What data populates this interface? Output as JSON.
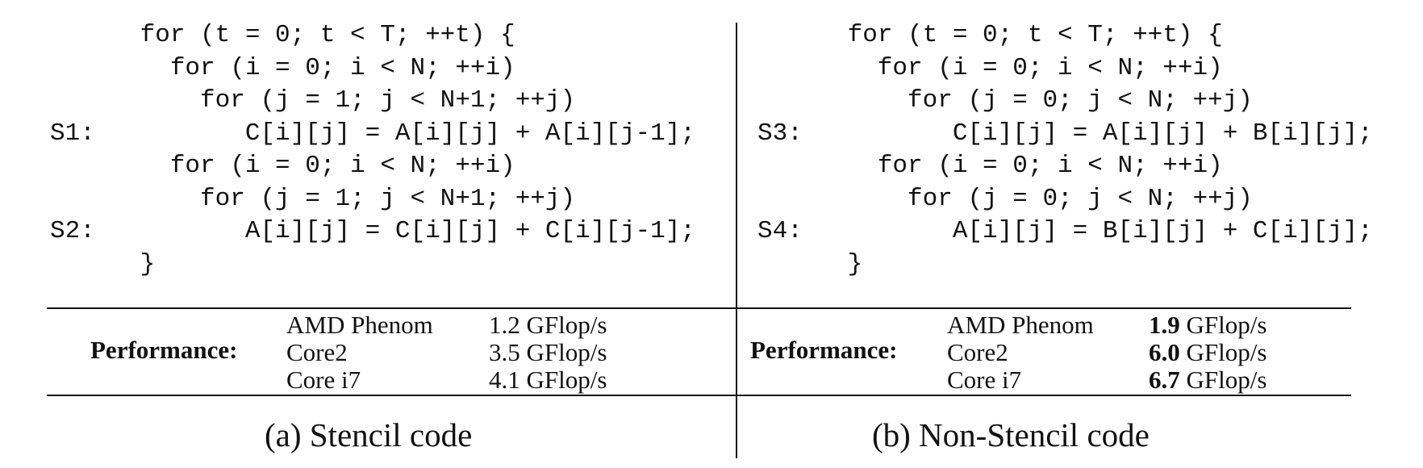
{
  "panels": [
    {
      "code_lines": [
        "      for (t = 0; t < T; ++t) {",
        "        for (i = 0; i < N; ++i)",
        "          for (j = 1; j < N+1; ++j)",
        "S1:          C[i][j] = A[i][j] + A[i][j-1];",
        "        for (i = 0; i < N; ++i)",
        "          for (j = 1; j < N+1; ++j)",
        "S2:          A[i][j] = C[i][j] + C[i][j-1];",
        "      }"
      ],
      "performance_label": "Performance:",
      "performance": [
        {
          "machine": "AMD Phenom",
          "value": "1.2",
          "unit": " GFlop/s"
        },
        {
          "machine": "Core2",
          "value": "3.5",
          "unit": " GFlop/s"
        },
        {
          "machine": "Core i7",
          "value": "4.1",
          "unit": " GFlop/s"
        }
      ],
      "caption": "(a) Stencil code"
    },
    {
      "code_lines": [
        "      for (t = 0; t < T; ++t) {",
        "        for (i = 0; i < N; ++i)",
        "          for (j = 0; j < N; ++j)",
        "S3:          C[i][j] = A[i][j] + B[i][j];",
        "        for (i = 0; i < N; ++i)",
        "          for (j = 0; j < N; ++j)",
        "S4:          A[i][j] = B[i][j] + C[i][j];",
        "      }"
      ],
      "performance_label": "Performance:",
      "performance": [
        {
          "machine": "AMD Phenom",
          "value": "1.9",
          "unit": " GFlop/s"
        },
        {
          "machine": "Core2",
          "value": "6.0",
          "unit": " GFlop/s"
        },
        {
          "machine": "Core i7",
          "value": "6.7",
          "unit": " GFlop/s"
        }
      ],
      "caption": "(b) Non-Stencil code"
    }
  ]
}
